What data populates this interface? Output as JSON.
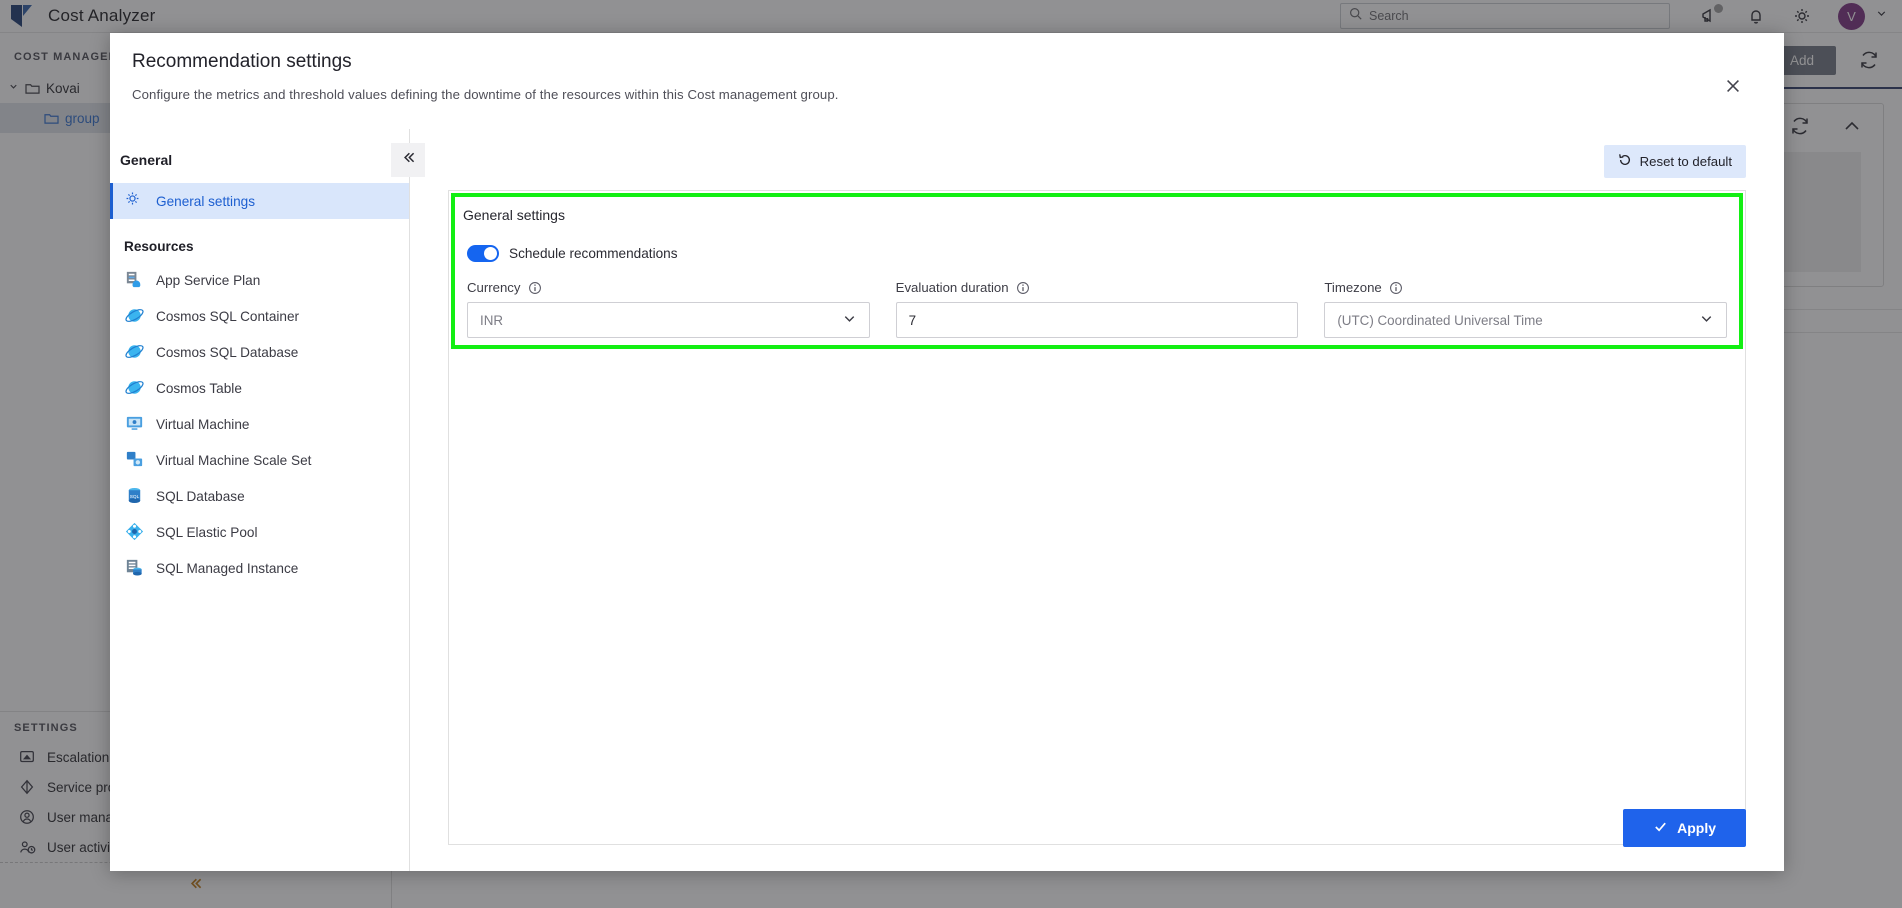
{
  "topbar": {
    "app_title": "Cost Analyzer",
    "logo_icon": "kovai-logo-icon",
    "search_placeholder": "Search",
    "search_icon": "search-icon",
    "icons": [
      {
        "name": "announcement-icon",
        "badge": true
      },
      {
        "name": "bell-icon",
        "badge": false
      },
      {
        "name": "gear-icon",
        "badge": false
      }
    ],
    "avatar_initial": "V",
    "avatar_color": "#7a2f7f",
    "avatar_chevron_icon": "chevron-down-icon"
  },
  "sidebar": {
    "section_title": "COST MANAGEMENT",
    "tree": [
      {
        "label": "Kovai",
        "icon": "folder-icon",
        "expanded": true,
        "level": 0
      },
      {
        "label": "group",
        "icon": "folder-icon",
        "expanded": false,
        "level": 1,
        "selected": true
      }
    ],
    "settings_title": "SETTINGS",
    "settings_items": [
      {
        "label": "Escalation",
        "icon": "escalation-icon"
      },
      {
        "label": "Service provider",
        "icon": "service-provider-icon"
      },
      {
        "label": "User management",
        "icon": "user-management-icon"
      },
      {
        "label": "User activity",
        "icon": "user-activity-icon"
      }
    ],
    "collapse_icon": "double-chevron-left-icon"
  },
  "main": {
    "add_button": "Add",
    "refresh_icon": "refresh-icon",
    "collapse_panel_icon": "chevron-up-icon"
  },
  "modal": {
    "title": "Recommendation settings",
    "subtitle": "Configure the metrics and threshold values defining the downtime of the resources within this Cost management group.",
    "close_icon": "close-icon",
    "nav": {
      "general_heading": "General",
      "collapse_icon": "double-chevron-left-icon",
      "general_items": [
        {
          "label": "General settings",
          "icon": "gear-icon",
          "active": true
        }
      ],
      "resources_heading": "Resources",
      "resource_items": [
        {
          "label": "App Service Plan",
          "icon": "app-service-plan-icon"
        },
        {
          "label": "Cosmos SQL Container",
          "icon": "cosmos-db-icon"
        },
        {
          "label": "Cosmos SQL Database",
          "icon": "cosmos-db-icon"
        },
        {
          "label": "Cosmos Table",
          "icon": "cosmos-db-icon"
        },
        {
          "label": "Virtual Machine",
          "icon": "virtual-machine-icon"
        },
        {
          "label": "Virtual Machine Scale Set",
          "icon": "vm-scale-set-icon"
        },
        {
          "label": "SQL Database",
          "icon": "sql-database-icon"
        },
        {
          "label": "SQL Elastic Pool",
          "icon": "sql-elastic-pool-icon"
        },
        {
          "label": "SQL Managed Instance",
          "icon": "sql-managed-instance-icon"
        }
      ]
    },
    "reset_button": "Reset to default",
    "reset_icon": "reset-icon",
    "panel": {
      "title": "General settings",
      "highlight_color": "#13ef13",
      "toggle": {
        "label": "Schedule recommendations",
        "enabled": true,
        "accent_color": "#1565f0"
      },
      "fields": [
        {
          "label": "Currency",
          "value": "INR",
          "type": "select",
          "info_icon": "info-icon",
          "chevron_icon": "chevron-down-icon"
        },
        {
          "label": "Evaluation duration",
          "value": "7",
          "type": "text",
          "info_icon": "info-icon"
        },
        {
          "label": "Timezone",
          "value": "(UTC) Coordinated Universal Time",
          "type": "select",
          "info_icon": "info-icon",
          "chevron_icon": "chevron-down-icon"
        }
      ]
    },
    "apply_button": "Apply",
    "apply_icon": "check-icon",
    "apply_color": "#1f63eb"
  }
}
